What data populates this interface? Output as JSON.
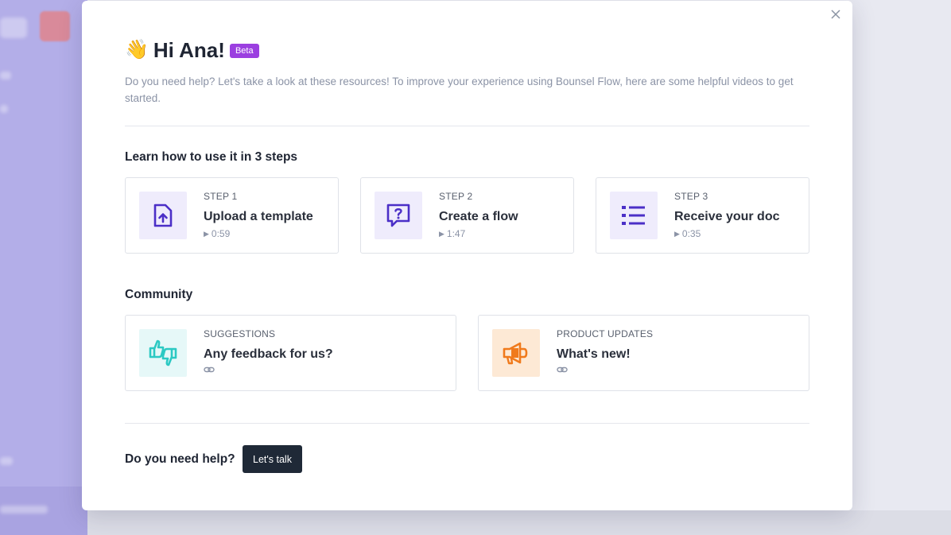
{
  "modal": {
    "close_icon": "close-icon",
    "greeting_emoji": "👋",
    "title": "Hi Ana!",
    "badge": "Beta",
    "intro": "Do you need help? Let's take a look at these resources! To improve your experience using Bounsel Flow, here are some helpful videos to get started."
  },
  "learn": {
    "title": "Learn how to use it in 3 steps",
    "steps": [
      {
        "kicker": "STEP 1",
        "title": "Upload a template",
        "duration": "0:59",
        "icon": "upload-file-icon"
      },
      {
        "kicker": "STEP 2",
        "title": "Create a flow",
        "duration": "1:47",
        "icon": "question-chat-icon"
      },
      {
        "kicker": "STEP 3",
        "title": "Receive your doc",
        "duration": "0:35",
        "icon": "list-icon"
      }
    ]
  },
  "community": {
    "title": "Community",
    "items": [
      {
        "kicker": "SUGGESTIONS",
        "title": "Any feedback for us?",
        "icon": "thumbs-feedback-icon",
        "link_icon": "link-icon"
      },
      {
        "kicker": "PRODUCT UPDATES",
        "title": "What's new!",
        "icon": "megaphone-icon",
        "link_icon": "link-icon"
      }
    ]
  },
  "footer": {
    "help_text": "Do you need help?",
    "button_label": "Let's talk"
  },
  "colors": {
    "accent_purple": "#4b2fc7",
    "icon_bg_purple": "#efecfc",
    "icon_bg_teal": "#e6f8f8",
    "teal": "#2cc9c3",
    "icon_bg_orange": "#fde9d5",
    "orange": "#f07a1c",
    "badge": "#9b3fe0",
    "button_dark": "#1f2937"
  }
}
